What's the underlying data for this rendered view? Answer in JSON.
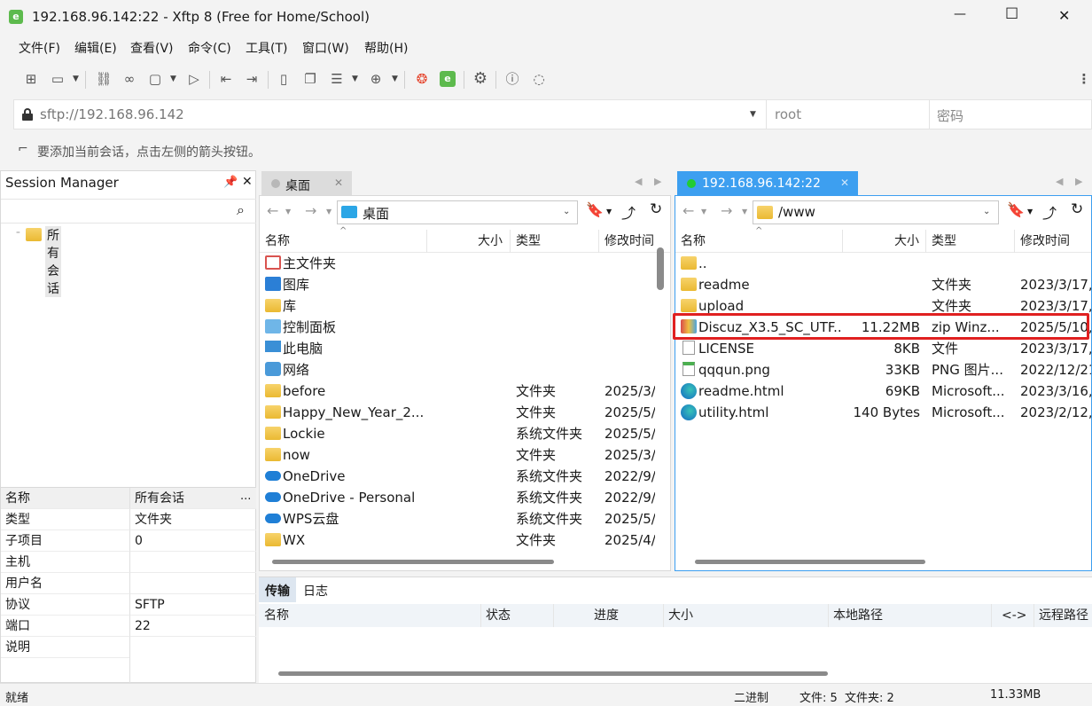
{
  "window": {
    "title": "192.168.96.142:22 - Xftp 8 (Free for Home/School)",
    "minimize": "—",
    "maximize": "☐",
    "close": "✕"
  },
  "menu": [
    "文件(F)",
    "编辑(E)",
    "查看(V)",
    "命令(C)",
    "工具(T)",
    "窗口(W)",
    "帮助(H)"
  ],
  "address": {
    "url": "sftp://192.168.96.142",
    "user": "root",
    "password_placeholder": "密码"
  },
  "hint": "要添加当前会话，点击左侧的箭头按钮。",
  "session_manager": {
    "title": "Session Manager",
    "tree_root": "所有会话",
    "properties": [
      {
        "key": "名称",
        "value": "所有会话"
      },
      {
        "key": "类型",
        "value": "文件夹"
      },
      {
        "key": "子项目",
        "value": "0"
      },
      {
        "key": "主机",
        "value": ""
      },
      {
        "key": "用户名",
        "value": ""
      },
      {
        "key": "协议",
        "value": "SFTP"
      },
      {
        "key": "端口",
        "value": "22"
      },
      {
        "key": "说明",
        "value": ""
      }
    ],
    "more": "..."
  },
  "local": {
    "tab": "桌面",
    "path": "桌面",
    "columns": {
      "name": "名称",
      "size": "大小",
      "type": "类型",
      "modified": "修改时间"
    },
    "rows": [
      {
        "name": "主文件夹",
        "size": "",
        "type": "",
        "modified": "",
        "icon": "home-icon"
      },
      {
        "name": "图库",
        "size": "",
        "type": "",
        "modified": "",
        "icon": "gallery-icon"
      },
      {
        "name": "库",
        "size": "",
        "type": "",
        "modified": "",
        "icon": "folder-icon"
      },
      {
        "name": "控制面板",
        "size": "",
        "type": "",
        "modified": "",
        "icon": "control-panel-icon"
      },
      {
        "name": "此电脑",
        "size": "",
        "type": "",
        "modified": "",
        "icon": "computer-icon"
      },
      {
        "name": "网络",
        "size": "",
        "type": "",
        "modified": "",
        "icon": "network-icon"
      },
      {
        "name": "before",
        "size": "",
        "type": "文件夹",
        "modified": "2025/3/",
        "icon": "folder-icon"
      },
      {
        "name": "Happy_New_Year_2...",
        "size": "",
        "type": "文件夹",
        "modified": "2025/5/",
        "icon": "folder-icon"
      },
      {
        "name": "Lockie",
        "size": "",
        "type": "系统文件夹",
        "modified": "2025/5/",
        "icon": "folder-icon"
      },
      {
        "name": "now",
        "size": "",
        "type": "文件夹",
        "modified": "2025/3/",
        "icon": "folder-icon"
      },
      {
        "name": "OneDrive",
        "size": "",
        "type": "系统文件夹",
        "modified": "2022/9/",
        "icon": "cloud-icon"
      },
      {
        "name": "OneDrive - Personal",
        "size": "",
        "type": "系统文件夹",
        "modified": "2022/9/",
        "icon": "cloud-icon"
      },
      {
        "name": "WPS云盘",
        "size": "",
        "type": "系统文件夹",
        "modified": "2025/5/",
        "icon": "cloud-icon"
      },
      {
        "name": "WX",
        "size": "",
        "type": "文件夹",
        "modified": "2025/4/",
        "icon": "folder-icon"
      }
    ]
  },
  "remote": {
    "tab": "192.168.96.142:22",
    "path": "/www",
    "columns": {
      "name": "名称",
      "size": "大小",
      "type": "类型",
      "modified": "修改时间"
    },
    "rows": [
      {
        "name": "..",
        "size": "",
        "type": "",
        "modified": "",
        "icon": "folder-icon"
      },
      {
        "name": "readme",
        "size": "",
        "type": "文件夹",
        "modified": "2023/3/17,",
        "icon": "folder-icon"
      },
      {
        "name": "upload",
        "size": "",
        "type": "文件夹",
        "modified": "2023/3/17,",
        "icon": "folder-icon"
      },
      {
        "name": "Discuz_X3.5_SC_UTF...",
        "size": "11.22MB",
        "type": "zip Winz...",
        "modified": "2025/5/10,",
        "icon": "zip-archive-icon"
      },
      {
        "name": "LICENSE",
        "size": "8KB",
        "type": "文件",
        "modified": "2023/3/17,",
        "icon": "file-icon"
      },
      {
        "name": "qqqun.png",
        "size": "33KB",
        "type": "PNG 图片...",
        "modified": "2022/12/21",
        "icon": "image-file-icon"
      },
      {
        "name": "readme.html",
        "size": "69KB",
        "type": "Microsoft...",
        "modified": "2023/3/16,",
        "icon": "edge-icon"
      },
      {
        "name": "utility.html",
        "size": "140 Bytes",
        "type": "Microsoft...",
        "modified": "2023/2/12,",
        "icon": "edge-icon"
      }
    ],
    "highlight_color": "#e02020"
  },
  "transfer": {
    "tabs": [
      "传输",
      "日志"
    ],
    "columns": [
      "名称",
      "状态",
      "进度",
      "大小",
      "本地路径",
      "<->",
      "远程路径"
    ]
  },
  "status": {
    "left": "就绪",
    "mode": "二进制",
    "counts": "文件: 5  文件夹: 2",
    "size": "11.33MB"
  },
  "colors": {
    "accent": "#2c8ef0",
    "remote_tab": "#3d9ff0",
    "connected_dot": "#22cc33"
  }
}
